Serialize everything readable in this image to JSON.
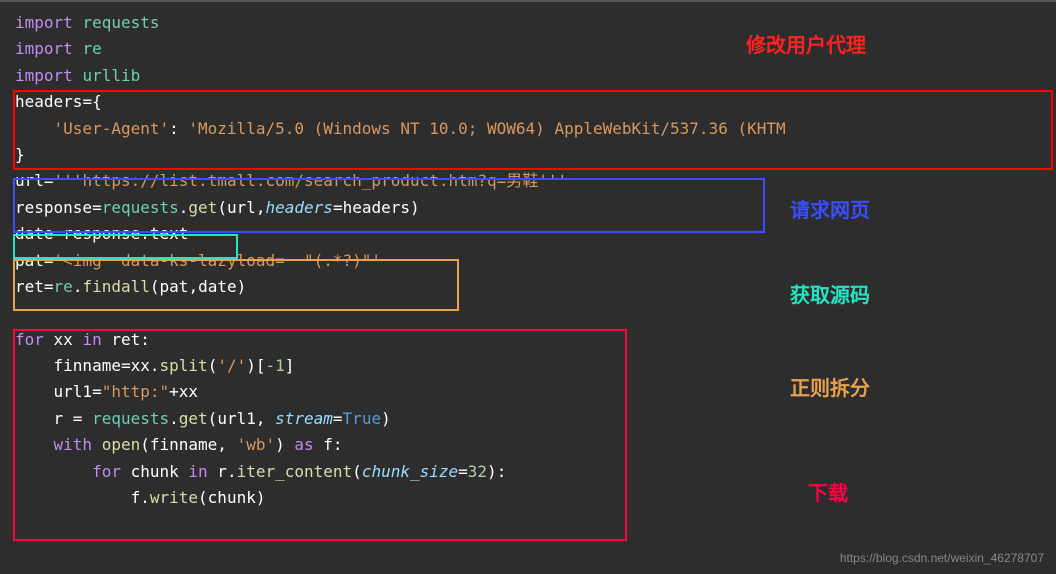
{
  "code": {
    "l1_kw": "import",
    "l1_mod": "requests",
    "l2_kw": "import",
    "l2_mod": "re",
    "l3_kw": "import",
    "l3_mod": "urllib",
    "l4_var": "headers",
    "l4_op": "=",
    "l4_brace": "{",
    "l5_key": "'User-Agent'",
    "l5_colon": ": ",
    "l5_val": "'Mozilla/5.0 (Windows NT 10.0; WOW64) AppleWebKit/537.36 (KHTM",
    "l6_brace": "}",
    "l7_var": "url",
    "l7_op": "=",
    "l7_str": "'''https://list.tmall.com/search_product.htm?q=男鞋'''",
    "l8_var": "response",
    "l8_op": "=",
    "l8_mod": "requests",
    "l8_dot": ".",
    "l8_func": "get",
    "l8_p1": "(",
    "l8_arg1": "url",
    "l8_c": ",",
    "l8_param": "headers",
    "l8_eq": "=",
    "l8_arg2": "headers",
    "l8_p2": ")",
    "l9_var": "date",
    "l9_op": "=",
    "l9_expr": "response.text",
    "l10_var": "pat",
    "l10_op": "=",
    "l10_str": "'<img  data-ks-lazyload=  \"(.*?)\"'",
    "l11_var": "ret",
    "l11_op": "=",
    "l11_mod": "re",
    "l11_dot": ".",
    "l11_func": "findall",
    "l11_p1": "(",
    "l11_arg1": "pat",
    "l11_c": ",",
    "l11_arg2": "date",
    "l11_p2": ")",
    "l12_kw": "for",
    "l12_var": " xx ",
    "l12_in": "in",
    "l12_iter": " ret",
    "l12_colon": ":",
    "l13_var": "finname",
    "l13_op": "=",
    "l13_expr1": "xx.",
    "l13_func": "split",
    "l13_p1": "(",
    "l13_str": "'/'",
    "l13_p2": ")[",
    "l13_num": "-1",
    "l13_p3": "]",
    "l14_var": "url1",
    "l14_op": "=",
    "l14_str": "\"http:\"",
    "l14_plus": "+",
    "l14_xx": "xx",
    "l15_var": "r ",
    "l15_op": "= ",
    "l15_mod": "requests",
    "l15_dot": ".",
    "l15_func": "get",
    "l15_p1": "(",
    "l15_arg": "url1, ",
    "l15_param": "stream",
    "l15_eq": "=",
    "l15_bool": "True",
    "l15_p2": ")",
    "l16_kw": "with",
    "l16_sp": " ",
    "l16_func": "open",
    "l16_p1": "(",
    "l16_arg": "finname, ",
    "l16_str": "'wb'",
    "l16_p2": ") ",
    "l16_as": "as",
    "l16_f": " f",
    "l16_colon": ":",
    "l17_kw": "for",
    "l17_var": " chunk ",
    "l17_in": "in",
    "l17_r": " r.",
    "l17_func": "iter_content",
    "l17_p1": "(",
    "l17_param": "chunk_size",
    "l17_eq": "=",
    "l17_num": "32",
    "l17_p2": ")",
    "l17_colon": ":",
    "l18_f": "f.",
    "l18_func": "write",
    "l18_p1": "(",
    "l18_arg": "chunk",
    "l18_p2": ")"
  },
  "annotations": {
    "a1": "修改用户代理",
    "a2": "请求网页",
    "a3": "获取源码",
    "a4": "正则拆分",
    "a5": "下载"
  },
  "watermark": "https://blog.csdn.net/weixin_46278707"
}
